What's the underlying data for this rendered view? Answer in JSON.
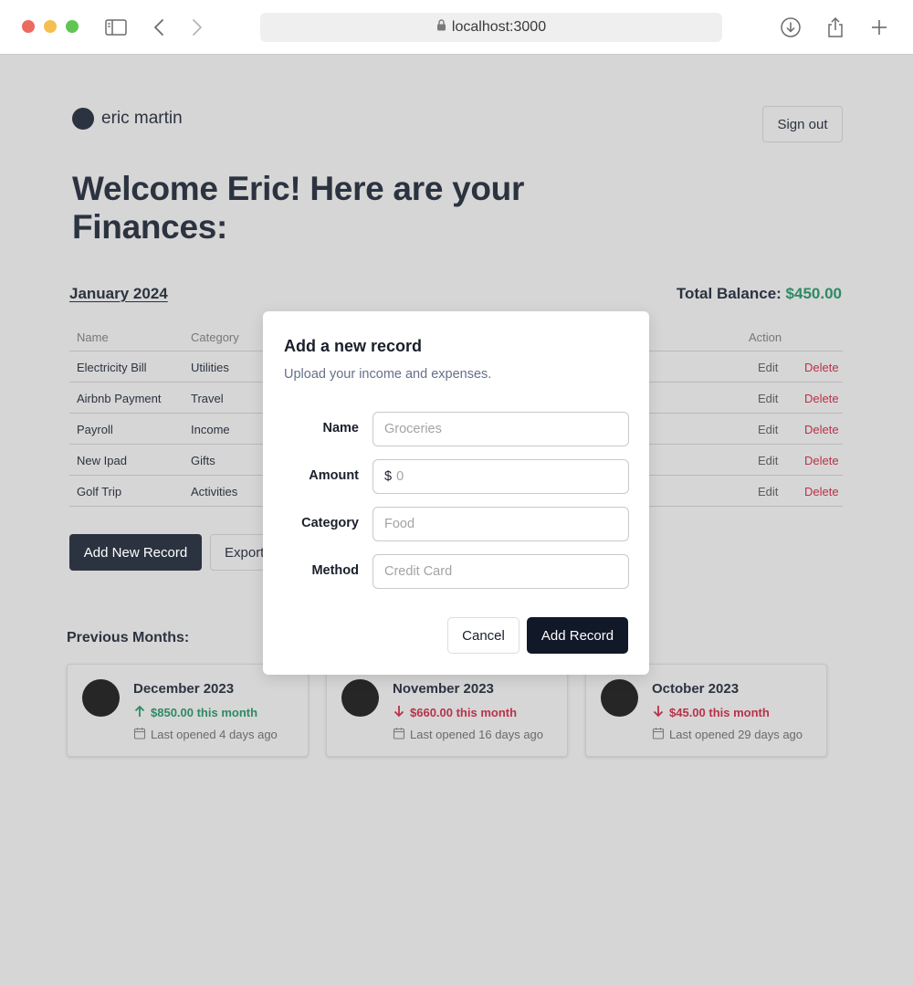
{
  "browser": {
    "url": "localhost:3000",
    "icons": [
      "close-dot",
      "minimize-dot",
      "maximize-dot",
      "sidebar-icon",
      "back-icon",
      "forward-icon",
      "lock-icon",
      "download-icon",
      "share-icon",
      "new-tab-icon"
    ]
  },
  "header": {
    "user_name": "eric martin",
    "sign_out_label": "Sign out"
  },
  "welcome": {
    "line1": "Welcome Eric! Here are your",
    "line2": "Finances:"
  },
  "records": {
    "month": "January 2024",
    "balance_label": "Total Balance:",
    "balance_value": "$450.00",
    "columns": {
      "name": "Name",
      "category": "Category",
      "action": "Action"
    },
    "rows": [
      {
        "name": "Electricity Bill",
        "category": "Utilities",
        "edit": "Edit",
        "delete": "Delete"
      },
      {
        "name": "Airbnb Payment",
        "category": "Travel",
        "edit": "Edit",
        "delete": "Delete"
      },
      {
        "name": "Payroll",
        "category": "Income",
        "edit": "Edit",
        "delete": "Delete"
      },
      {
        "name": "New Ipad",
        "category": "Gifts",
        "edit": "Edit",
        "delete": "Delete"
      },
      {
        "name": "Golf Trip",
        "category": "Activities",
        "edit": "Edit",
        "delete": "Delete"
      }
    ],
    "add_button": "Add New Record",
    "export_button": "Export"
  },
  "previous": {
    "title": "Previous Months:",
    "cards": [
      {
        "title": "December 2023",
        "change": "$850.00 this month",
        "direction": "up",
        "last_opened": "Last opened 4 days ago"
      },
      {
        "title": "November 2023",
        "change": "$660.00 this month",
        "direction": "down",
        "last_opened": "Last opened 16 days ago"
      },
      {
        "title": "October 2023",
        "change": "$45.00 this month",
        "direction": "down",
        "last_opened": "Last opened 29 days ago"
      }
    ]
  },
  "modal": {
    "title": "Add a new record",
    "description": "Upload your income and expenses.",
    "fields": {
      "name": {
        "label": "Name",
        "placeholder": "Groceries",
        "value": ""
      },
      "amount": {
        "label": "Amount",
        "prefix": "$",
        "placeholder": "0",
        "value": ""
      },
      "category": {
        "label": "Category",
        "placeholder": "Food",
        "value": ""
      },
      "method": {
        "label": "Method",
        "placeholder": "Credit Card",
        "value": ""
      }
    },
    "cancel_label": "Cancel",
    "submit_label": "Add Record"
  },
  "colors": {
    "background": "#d6d6d6",
    "primary_dark": "#2c3340",
    "positive": "#2d8a64",
    "negative": "#b8324a",
    "modal_button": "#111827"
  }
}
